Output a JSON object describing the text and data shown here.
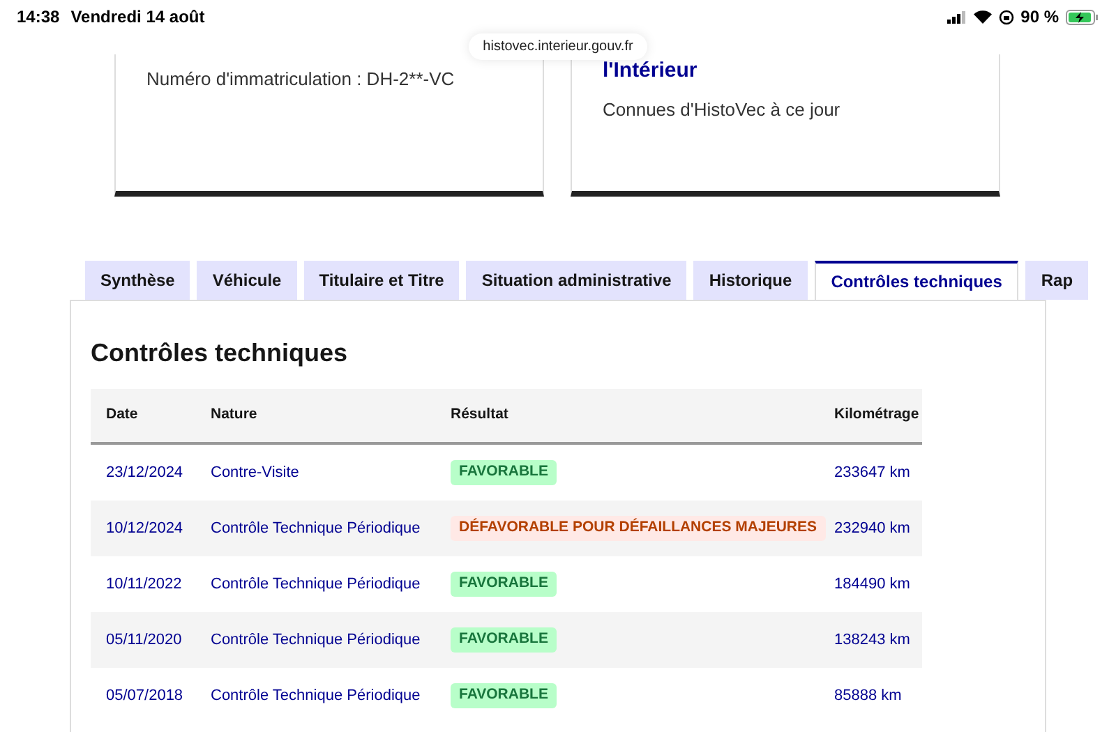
{
  "status_bar": {
    "time": "14:38",
    "date": "Vendredi 14 août",
    "battery": "90 %"
  },
  "address_bar": {
    "url": "histovec.interieur.gouv.fr"
  },
  "cards": [
    {
      "text": "Numéro d'immatriculation : DH-2**-VC"
    },
    {
      "title": "l'Intérieur",
      "text": "Connues d'HistoVec à ce jour"
    }
  ],
  "tabs": [
    {
      "label": "Synthèse",
      "selected": false
    },
    {
      "label": "Véhicule",
      "selected": false
    },
    {
      "label": "Titulaire et Titre",
      "selected": false
    },
    {
      "label": "Situation administrative",
      "selected": false
    },
    {
      "label": "Historique",
      "selected": false
    },
    {
      "label": "Contrôles techniques",
      "selected": true
    },
    {
      "label": "Rap",
      "selected": false
    }
  ],
  "panel": {
    "heading": "Contrôles techniques",
    "table": {
      "columns": [
        "Date",
        "Nature",
        "Résultat",
        "Kilométrage"
      ],
      "rows": [
        {
          "date": "23/12/2024",
          "nature": "Contre-Visite",
          "result": {
            "label": "FAVORABLE",
            "kind": "favorable"
          },
          "km": "233647 km"
        },
        {
          "date": "10/12/2024",
          "nature": "Contrôle Technique Périodique",
          "result": {
            "label": "DÉFAVORABLE POUR DÉFAILLANCES MAJEURES",
            "kind": "defavorable"
          },
          "km": "232940 km"
        },
        {
          "date": "10/11/2022",
          "nature": "Contrôle Technique Périodique",
          "result": {
            "label": "FAVORABLE",
            "kind": "favorable"
          },
          "km": "184490 km"
        },
        {
          "date": "05/11/2020",
          "nature": "Contrôle Technique Périodique",
          "result": {
            "label": "FAVORABLE",
            "kind": "favorable"
          },
          "km": "138243 km"
        },
        {
          "date": "05/07/2018",
          "nature": "Contrôle Technique Périodique",
          "result": {
            "label": "FAVORABLE",
            "kind": "favorable"
          },
          "km": "85888 km"
        }
      ]
    }
  }
}
